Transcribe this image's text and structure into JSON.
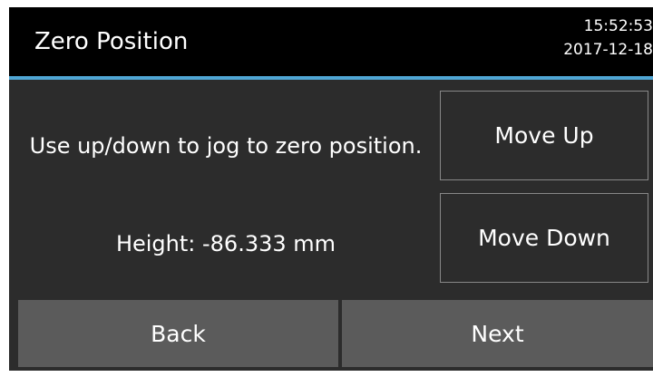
{
  "header": {
    "title": "Zero Position",
    "time": "15:52:53",
    "date": "2017-12-18"
  },
  "main": {
    "instruction": "Use up/down to jog to zero position.",
    "height_readout": "Height: -86.333 mm"
  },
  "buttons": {
    "move_up": "Move Up",
    "move_down": "Move Down",
    "back": "Back",
    "next": "Next"
  },
  "colors": {
    "header_background": "#000000",
    "header_rule": "#4fa6d4",
    "panel_background": "#2c2c2c",
    "nav_button": "#5b5b5b",
    "text": "#ffffff"
  }
}
